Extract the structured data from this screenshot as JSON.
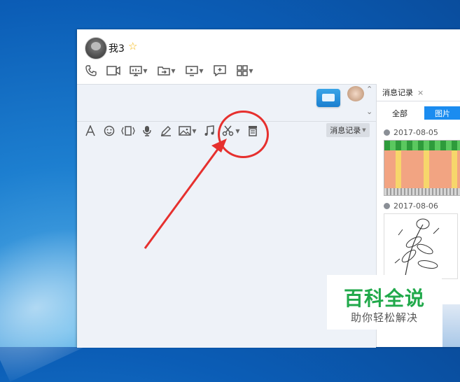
{
  "header": {
    "username": "我3",
    "star": "☆"
  },
  "toolbar_top": {
    "icons": [
      "phone-icon",
      "video-icon",
      "screen-share-icon",
      "transfer-file-icon",
      "remote-desktop-icon",
      "app-add-icon",
      "grid-apps-icon"
    ]
  },
  "toolbar_input": {
    "icons": [
      "font-icon",
      "emoji-icon",
      "shake-icon",
      "voice-icon",
      "pen-icon",
      "image-icon",
      "music-icon",
      "scissors-icon",
      "history-icon"
    ],
    "message_record_label": "消息记录"
  },
  "panel": {
    "tab_label": "消息记录",
    "tab_close": "×",
    "filter_all": "全部",
    "filter_images": "图片",
    "dates": [
      "2017-08-05",
      "2017-08-06"
    ]
  },
  "watermark": {
    "title": "百科全说",
    "subtitle": "助你轻松解决"
  },
  "colors": {
    "accent": "#1b8cf0",
    "annotation_red": "#e6302e",
    "watermark_green": "#21a94b"
  }
}
